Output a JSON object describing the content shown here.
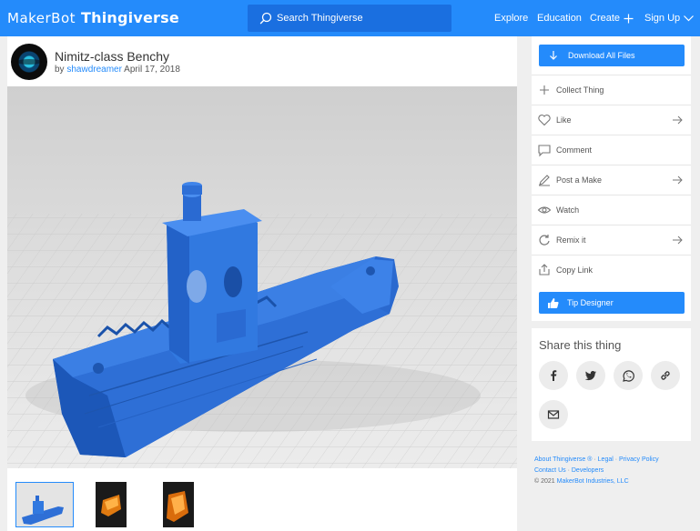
{
  "header": {
    "brand": "MakerBot",
    "product": "Thingiverse",
    "search_placeholder": "Search Thingiverse",
    "nav": {
      "explore": "Explore",
      "education": "Education",
      "create": "Create",
      "signup": "Sign Up"
    }
  },
  "thing": {
    "title": "Nimitz-class Benchy",
    "by": "by",
    "author": "shawdreamer",
    "date": "April 17, 2018"
  },
  "sidebar": {
    "download": "Download All Files",
    "actions": [
      {
        "label": "Collect Thing",
        "icon": "plus-icon"
      },
      {
        "label": "Like",
        "icon": "heart-icon"
      },
      {
        "label": "Comment",
        "icon": "comment-icon"
      },
      {
        "label": "Post a Make",
        "icon": "pencil-icon"
      },
      {
        "label": "Watch",
        "icon": "eye-icon"
      },
      {
        "label": "Remix it",
        "icon": "remix-icon"
      },
      {
        "label": "Copy Link",
        "icon": "share-icon"
      }
    ],
    "tip": "Tip Designer"
  },
  "share": {
    "title": "Share this thing",
    "targets": [
      "facebook-icon",
      "twitter-icon",
      "whatsapp-icon",
      "link-icon",
      "email-icon"
    ]
  },
  "footer": {
    "about": "About Thingiverse ®",
    "legal": "Legal",
    "privacy": "Privacy Policy",
    "contact": "Contact Us",
    "developers": "Developers",
    "copyright_prefix": "©  2021",
    "company": "MakerBot Industries, LLC"
  },
  "colors": {
    "accent": "#248bfb",
    "model": "#2e72d6"
  }
}
